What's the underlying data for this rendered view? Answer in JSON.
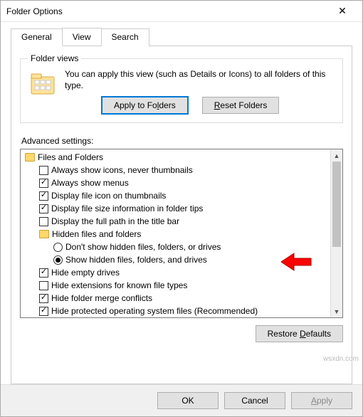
{
  "window": {
    "title": "Folder Options"
  },
  "tabs": {
    "general": "General",
    "view": "View",
    "search": "Search",
    "active": "view"
  },
  "folder_views": {
    "legend": "Folder views",
    "desc": "You can apply this view (such as Details or Icons) to all folders of this type.",
    "apply_btn": "Apply to Folders",
    "reset_btn": "Reset Folders"
  },
  "advanced_label": "Advanced settings:",
  "tree": {
    "root": "Files and Folders",
    "items": [
      {
        "type": "chk",
        "checked": false,
        "label": "Always show icons, never thumbnails"
      },
      {
        "type": "chk",
        "checked": true,
        "label": "Always show menus"
      },
      {
        "type": "chk",
        "checked": true,
        "label": "Display file icon on thumbnails"
      },
      {
        "type": "chk",
        "checked": true,
        "label": "Display file size information in folder tips"
      },
      {
        "type": "chk",
        "checked": false,
        "label": "Display the full path in the title bar"
      },
      {
        "type": "group",
        "label": "Hidden files and folders"
      },
      {
        "type": "rad",
        "checked": false,
        "label": "Don't show hidden files, folders, or drives"
      },
      {
        "type": "rad",
        "checked": true,
        "label": "Show hidden files, folders, and drives"
      },
      {
        "type": "chk",
        "checked": true,
        "label": "Hide empty drives"
      },
      {
        "type": "chk",
        "checked": false,
        "label": "Hide extensions for known file types"
      },
      {
        "type": "chk",
        "checked": true,
        "label": "Hide folder merge conflicts"
      },
      {
        "type": "chk",
        "checked": true,
        "label": "Hide protected operating system files (Recommended)"
      }
    ]
  },
  "restore_btn": "Restore Defaults",
  "footer": {
    "ok": "OK",
    "cancel": "Cancel",
    "apply": "Apply"
  },
  "watermark": "wsxdn.com"
}
